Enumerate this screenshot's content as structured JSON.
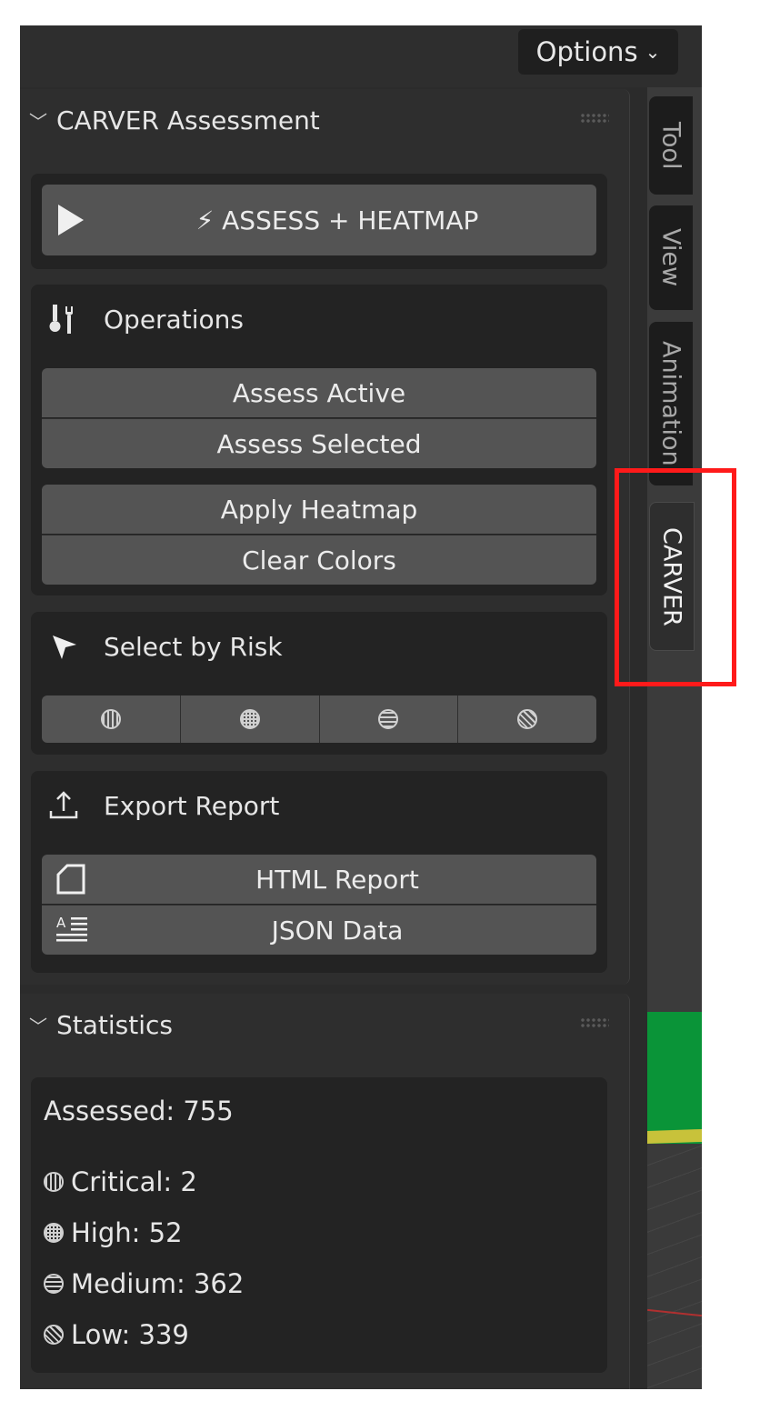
{
  "header": {
    "options_label": "Options"
  },
  "carver_panel": {
    "title": "CARVER Assessment",
    "assess_heatmap_label": "⚡ ASSESS + HEATMAP",
    "operations": {
      "heading": "Operations",
      "assess_active": "Assess Active",
      "assess_selected": "Assess Selected",
      "apply_heatmap": "Apply Heatmap",
      "clear_colors": "Clear Colors"
    },
    "select_by_risk": {
      "heading": "Select by Risk",
      "levels": [
        "critical",
        "high",
        "medium",
        "low"
      ]
    },
    "export_report": {
      "heading": "Export Report",
      "html_report": "HTML Report",
      "json_data": "JSON Data"
    }
  },
  "statistics": {
    "title": "Statistics",
    "assessed": "Assessed: 755",
    "critical": "Critical: 2",
    "high": "High: 52",
    "medium": "Medium: 362",
    "low": "Low: 339"
  },
  "tabs": [
    "Tool",
    "View",
    "Animation",
    "CARVER"
  ],
  "active_tab": "CARVER",
  "colors": {
    "panel_bg": "#2e2e2e",
    "button_bg": "#545454",
    "highlight": "#ff1a1a"
  }
}
